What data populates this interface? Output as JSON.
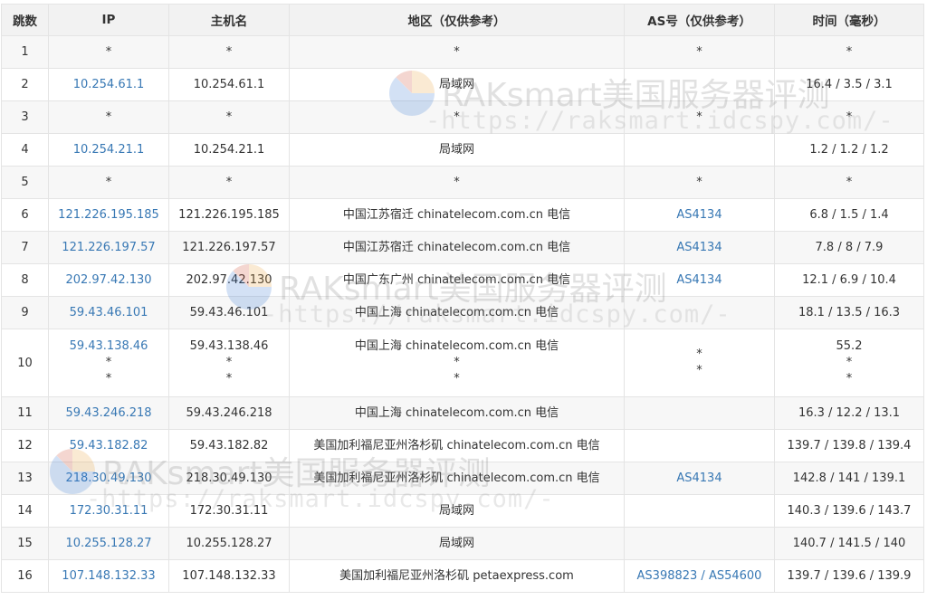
{
  "headers": [
    "跳数",
    "IP",
    "主机名",
    "地区（仅供参考）",
    "AS号（仅供参考）",
    "时间（毫秒）"
  ],
  "rows": [
    {
      "hop": "1",
      "ip": [
        "*"
      ],
      "host": [
        "*"
      ],
      "region": [
        "*"
      ],
      "as": [
        "*"
      ],
      "time": [
        "*"
      ]
    },
    {
      "hop": "2",
      "ip": [
        "10.254.61.1"
      ],
      "host": [
        "10.254.61.1"
      ],
      "region": [
        "局域网"
      ],
      "as": [
        ""
      ],
      "time": [
        "16.4 / 3.5 / 3.1"
      ]
    },
    {
      "hop": "3",
      "ip": [
        "*"
      ],
      "host": [
        "*"
      ],
      "region": [
        "*"
      ],
      "as": [
        "*"
      ],
      "time": [
        "*"
      ]
    },
    {
      "hop": "4",
      "ip": [
        "10.254.21.1"
      ],
      "host": [
        "10.254.21.1"
      ],
      "region": [
        "局域网"
      ],
      "as": [
        ""
      ],
      "time": [
        "1.2 / 1.2 / 1.2"
      ]
    },
    {
      "hop": "5",
      "ip": [
        "*"
      ],
      "host": [
        "*"
      ],
      "region": [
        "*"
      ],
      "as": [
        "*"
      ],
      "time": [
        "*"
      ]
    },
    {
      "hop": "6",
      "ip": [
        "121.226.195.185"
      ],
      "host": [
        "121.226.195.185"
      ],
      "region": [
        "中国江苏宿迁 chinatelecom.com.cn 电信"
      ],
      "as": [
        "AS4134"
      ],
      "time": [
        "6.8 / 1.5 / 1.4"
      ]
    },
    {
      "hop": "7",
      "ip": [
        "121.226.197.57"
      ],
      "host": [
        "121.226.197.57"
      ],
      "region": [
        "中国江苏宿迁 chinatelecom.com.cn 电信"
      ],
      "as": [
        "AS4134"
      ],
      "time": [
        "7.8 / 8 / 7.9"
      ]
    },
    {
      "hop": "8",
      "ip": [
        "202.97.42.130"
      ],
      "host": [
        "202.97.42.130"
      ],
      "region": [
        "中国广东广州 chinatelecom.com.cn 电信"
      ],
      "as": [
        "AS4134"
      ],
      "time": [
        "12.1 / 6.9 / 10.4"
      ]
    },
    {
      "hop": "9",
      "ip": [
        "59.43.46.101"
      ],
      "host": [
        "59.43.46.101"
      ],
      "region": [
        "中国上海 chinatelecom.com.cn 电信"
      ],
      "as": [
        ""
      ],
      "time": [
        "18.1 / 13.5 / 16.3"
      ]
    },
    {
      "hop": "10",
      "ip": [
        "59.43.138.46",
        "*",
        "*"
      ],
      "host": [
        "59.43.138.46",
        "*",
        "*"
      ],
      "region": [
        "中国上海 chinatelecom.com.cn 电信",
        "*",
        "*"
      ],
      "as": [
        "",
        "*",
        "*"
      ],
      "time": [
        "55.2",
        "*",
        "*"
      ]
    },
    {
      "hop": "11",
      "ip": [
        "59.43.246.218"
      ],
      "host": [
        "59.43.246.218"
      ],
      "region": [
        "中国上海 chinatelecom.com.cn 电信"
      ],
      "as": [
        ""
      ],
      "time": [
        "16.3 / 12.2 / 13.1"
      ]
    },
    {
      "hop": "12",
      "ip": [
        "59.43.182.82"
      ],
      "host": [
        "59.43.182.82"
      ],
      "region": [
        "美国加利福尼亚州洛杉矶 chinatelecom.com.cn 电信"
      ],
      "as": [
        ""
      ],
      "time": [
        "139.7 / 139.8 / 139.4"
      ]
    },
    {
      "hop": "13",
      "ip": [
        "218.30.49.130"
      ],
      "host": [
        "218.30.49.130"
      ],
      "region": [
        "美国加利福尼亚州洛杉矶 chinatelecom.com.cn 电信"
      ],
      "as": [
        "AS4134"
      ],
      "time": [
        "142.8 / 141 / 139.1"
      ]
    },
    {
      "hop": "14",
      "ip": [
        "172.30.31.11"
      ],
      "host": [
        "172.30.31.11"
      ],
      "region": [
        "局域网"
      ],
      "as": [
        ""
      ],
      "time": [
        "140.3 / 139.6 / 143.7"
      ]
    },
    {
      "hop": "15",
      "ip": [
        "10.255.128.27"
      ],
      "host": [
        "10.255.128.27"
      ],
      "region": [
        "局域网"
      ],
      "as": [
        ""
      ],
      "time": [
        "140.7 / 141.5 / 140"
      ]
    },
    {
      "hop": "16",
      "ip": [
        "107.148.132.33"
      ],
      "host": [
        "107.148.132.33"
      ],
      "region": [
        "美国加利福尼亚州洛杉矶 petaexpress.com"
      ],
      "as": [
        "AS398823 / AS54600"
      ],
      "time": [
        "139.7 / 139.6 / 139.9"
      ]
    }
  ],
  "watermark": {
    "title": "RAKsmart美国服务器评测",
    "url": "-https://raksmart.idcspy.com/-"
  }
}
